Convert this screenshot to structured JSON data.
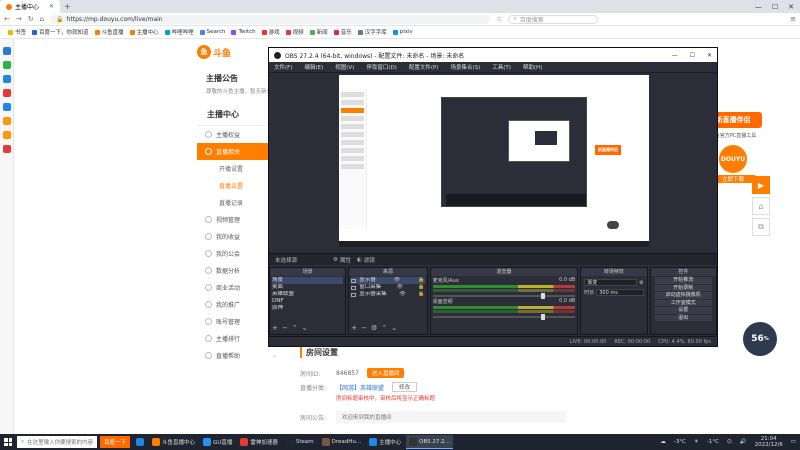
{
  "browser": {
    "tab_title": "主播中心",
    "url": "https://mp.douyu.com/live/main",
    "search_placeholder": "百度搜索",
    "bookmarks": [
      {
        "label": "书签",
        "color": "#f5b400"
      },
      {
        "label": "百度一下，你就知道",
        "color": "#2a62d6"
      },
      {
        "label": "斗鱼直播",
        "color": "#ff7e00"
      },
      {
        "label": "主播中心",
        "color": "#ff7e00"
      },
      {
        "label": "哔哩哔哩",
        "color": "#00a1d6"
      },
      {
        "label": "Search",
        "color": "#4285f4"
      },
      {
        "label": "Twitch",
        "color": "#9146ff"
      },
      {
        "label": "游戏",
        "color": "#e33"
      },
      {
        "label": "视频",
        "color": "#e33"
      },
      {
        "label": "新闻",
        "color": "#4caf50"
      },
      {
        "label": "音乐",
        "color": "#e91e63"
      },
      {
        "label": "汉字字库",
        "color": "#607d8b"
      },
      {
        "label": "pixiv",
        "color": "#0096fa"
      }
    ]
  },
  "page": {
    "logo_text": "斗鱼",
    "notice_title": "主播公告",
    "notice_text": "尊敬的斗鱼主播，暂无新公告",
    "sidebar_title": "主播中心",
    "sidebar": [
      {
        "label": "主播权益",
        "active": false
      },
      {
        "label": "直播相关",
        "active": true
      },
      {
        "label": "开播设置",
        "sub": true,
        "current": false
      },
      {
        "label": "直播设置",
        "sub": true,
        "current": true
      },
      {
        "label": "直播记录",
        "sub": true,
        "current": false
      },
      {
        "label": "视频管理",
        "active": false
      },
      {
        "label": "我的收益",
        "active": false
      },
      {
        "label": "我的公会",
        "active": false
      },
      {
        "label": "数据分析",
        "active": false
      },
      {
        "label": "商业活动",
        "active": false
      },
      {
        "label": "我的推广",
        "active": false
      },
      {
        "label": "账号管理",
        "active": false
      },
      {
        "label": "主播排行",
        "active": false
      },
      {
        "label": "直播帮助",
        "active": false
      }
    ],
    "room": {
      "title": "房间设置",
      "id_label": "房间ID:",
      "id_value": "846857",
      "id_button": "进入直播间",
      "cat_label": "直播分类:",
      "cat_value": "【网游】英雄联盟",
      "cat_button": "修改",
      "warning": "房间标题审核中，审核后将显示正确标题",
      "notice_label": "房间公告:",
      "notice_value": "欢迎来到我的直播间"
    },
    "promo": {
      "badge": "新直播伴侣",
      "sub": "斗鱼官方PC直播工具",
      "ball": "DOUYU",
      "button": "立即下载"
    },
    "speed_value": "56",
    "speed_unit": "%"
  },
  "obs": {
    "title": "OBS 27.2.4 (64-bit, windows) - 配置文件: 未命名 - 场景: 未命名",
    "menu": [
      "文件(F)",
      "编辑(E)",
      "视图(V)",
      "停靠窗口(D)",
      "配置文件(P)",
      "场景集合(S)",
      "工具(T)",
      "帮助(H)"
    ],
    "no_source": "未选择源",
    "prop_btn": "属性",
    "filter_btn": "滤镜",
    "docks": {
      "scenes": "场景",
      "sources": "来源",
      "mixer": "混音器",
      "transitions": "转场特效",
      "controls": "控件"
    },
    "scenes_list": [
      "场景",
      "桌面",
      "英雄联盟",
      "DNF",
      "原神"
    ],
    "sources_list": [
      "显示器",
      "窗口采集",
      "显示器采集"
    ],
    "mixer": [
      {
        "name": "麦克风/Aux",
        "db": "0.0 dB"
      },
      {
        "name": "桌面音频",
        "db": "0.0 dB"
      }
    ],
    "transition": {
      "type": "渐变",
      "duration_label": "时长",
      "duration": "300 ms"
    },
    "controls": [
      "开始推流",
      "开始录制",
      "启动虚拟摄像机",
      "工作室模式",
      "设置",
      "退出"
    ],
    "status": [
      "LIVE: 00:00:00",
      "REC: 00:00:00",
      "CPU: 4.4%, 60.00 fps"
    ]
  },
  "preview": {
    "pv_badge": "新直播伴侣"
  },
  "taskbar": {
    "search": "在这里输入你要搜索的内容",
    "hot": "百度一下",
    "apps": [
      {
        "label": "",
        "color": "#1e88e5"
      },
      {
        "label": "斗鱼直播中心",
        "color": "#ff7e00"
      },
      {
        "label": "GU直播",
        "color": "#2196f3"
      },
      {
        "label": "雷神加速器",
        "color": "#e53935"
      },
      {
        "label": "Steam",
        "color": "#1b2838"
      },
      {
        "label": "DreadHu...",
        "color": "#795548"
      },
      {
        "label": "主播中心",
        "color": "#1e88e5"
      },
      {
        "label": "OBS 27.2...",
        "color": "#333333",
        "active": true
      }
    ],
    "temp1": "-3°C",
    "temp2": "-1°C",
    "time": "21:04",
    "date": "2022/12/6"
  }
}
